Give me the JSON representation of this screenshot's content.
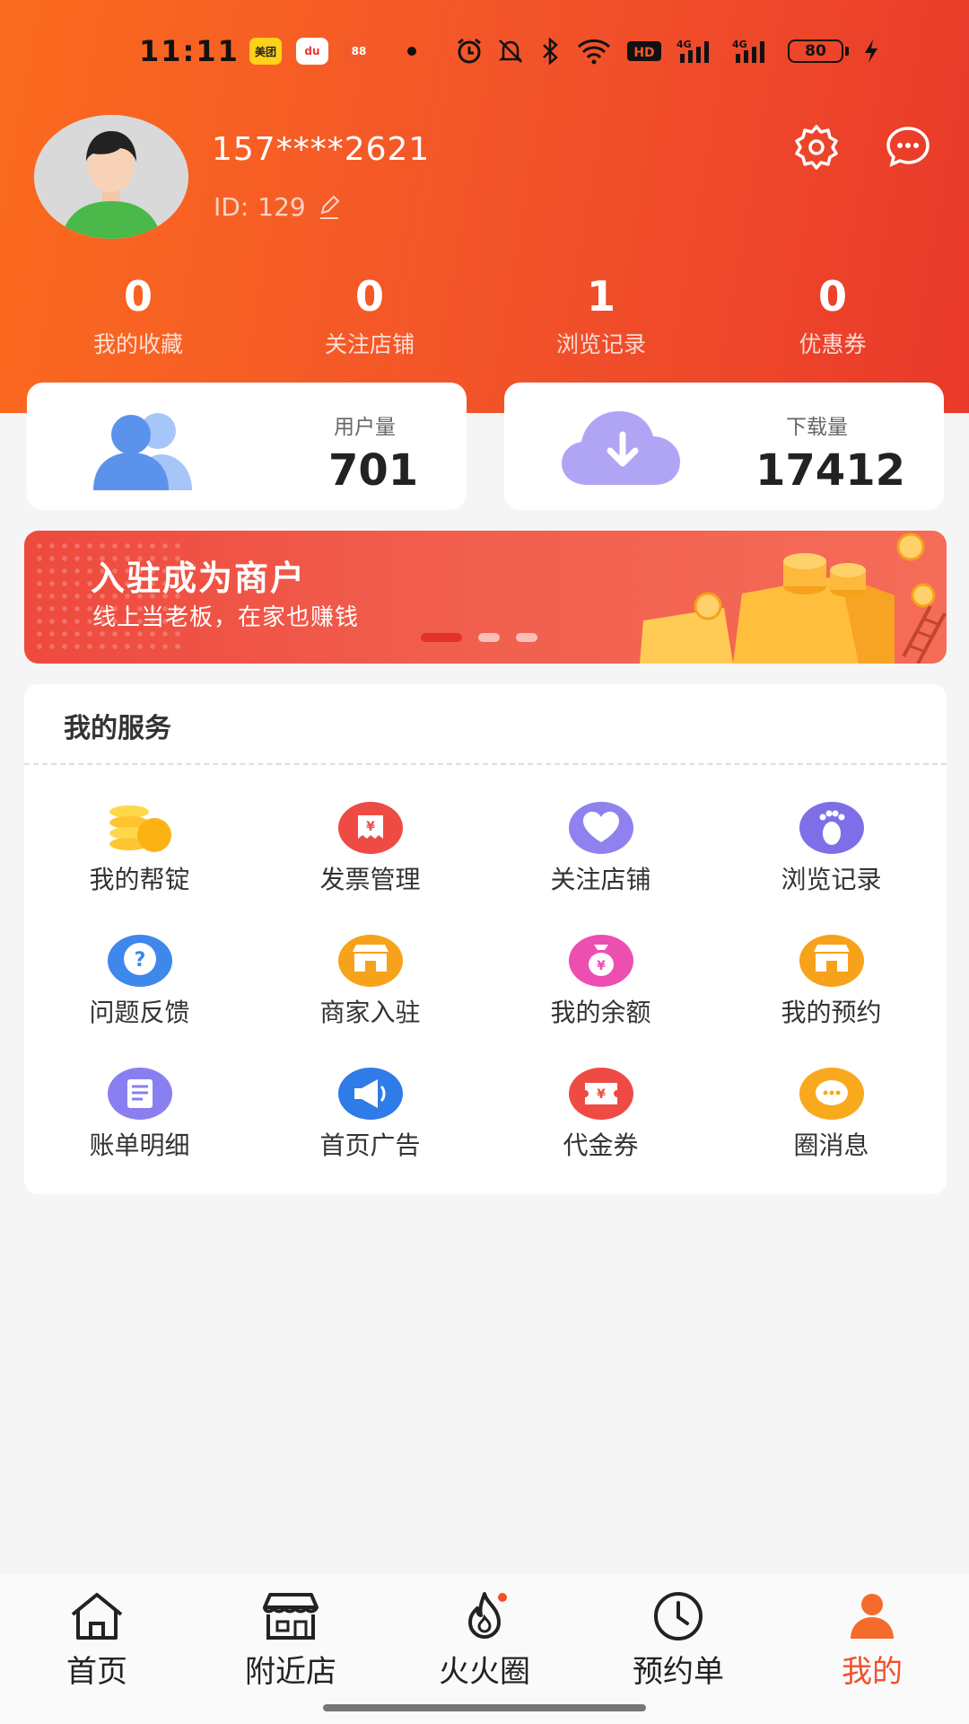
{
  "status_bar": {
    "time": "11:11",
    "apps": [
      "美团",
      "du",
      "88"
    ],
    "battery": "80",
    "network": [
      "HD",
      "4G",
      "4G"
    ]
  },
  "profile": {
    "phone": "157****2621",
    "id_label": "ID:",
    "id_value": "129"
  },
  "stats": [
    {
      "value": "0",
      "label": "我的收藏"
    },
    {
      "value": "0",
      "label": "关注店铺"
    },
    {
      "value": "1",
      "label": "浏览记录"
    },
    {
      "value": "0",
      "label": "优惠券"
    }
  ],
  "cards": {
    "users": {
      "label": "用户量",
      "value": "701"
    },
    "downloads": {
      "label": "下载量",
      "value": "17412"
    }
  },
  "banner": {
    "title": "入驻成为商户",
    "subtitle": "线上当老板，在家也赚钱"
  },
  "services": {
    "title": "我的服务",
    "items": [
      {
        "label": "我的帮锭",
        "icon": "coins-icon"
      },
      {
        "label": "发票管理",
        "icon": "invoice-icon"
      },
      {
        "label": "关注店铺",
        "icon": "heart-icon"
      },
      {
        "label": "浏览记录",
        "icon": "footprint-icon"
      },
      {
        "label": "问题反馈",
        "icon": "question-icon"
      },
      {
        "label": "商家入驻",
        "icon": "store-icon"
      },
      {
        "label": "我的余额",
        "icon": "moneybag-icon"
      },
      {
        "label": "我的预约",
        "icon": "store-icon"
      },
      {
        "label": "账单明细",
        "icon": "bill-icon"
      },
      {
        "label": "首页广告",
        "icon": "megaphone-icon"
      },
      {
        "label": "代金券",
        "icon": "voucher-icon"
      },
      {
        "label": "圈消息",
        "icon": "chat-icon"
      }
    ]
  },
  "tabbar": [
    {
      "label": "首页",
      "icon": "home-icon"
    },
    {
      "label": "附近店",
      "icon": "shop-icon"
    },
    {
      "label": "火火圈",
      "icon": "flame-icon"
    },
    {
      "label": "预约单",
      "icon": "clock-icon"
    },
    {
      "label": "我的",
      "icon": "user-icon"
    }
  ],
  "colors": {
    "accent": "#f0512b",
    "header_start": "#fb6b1e",
    "header_end": "#e9392a"
  }
}
